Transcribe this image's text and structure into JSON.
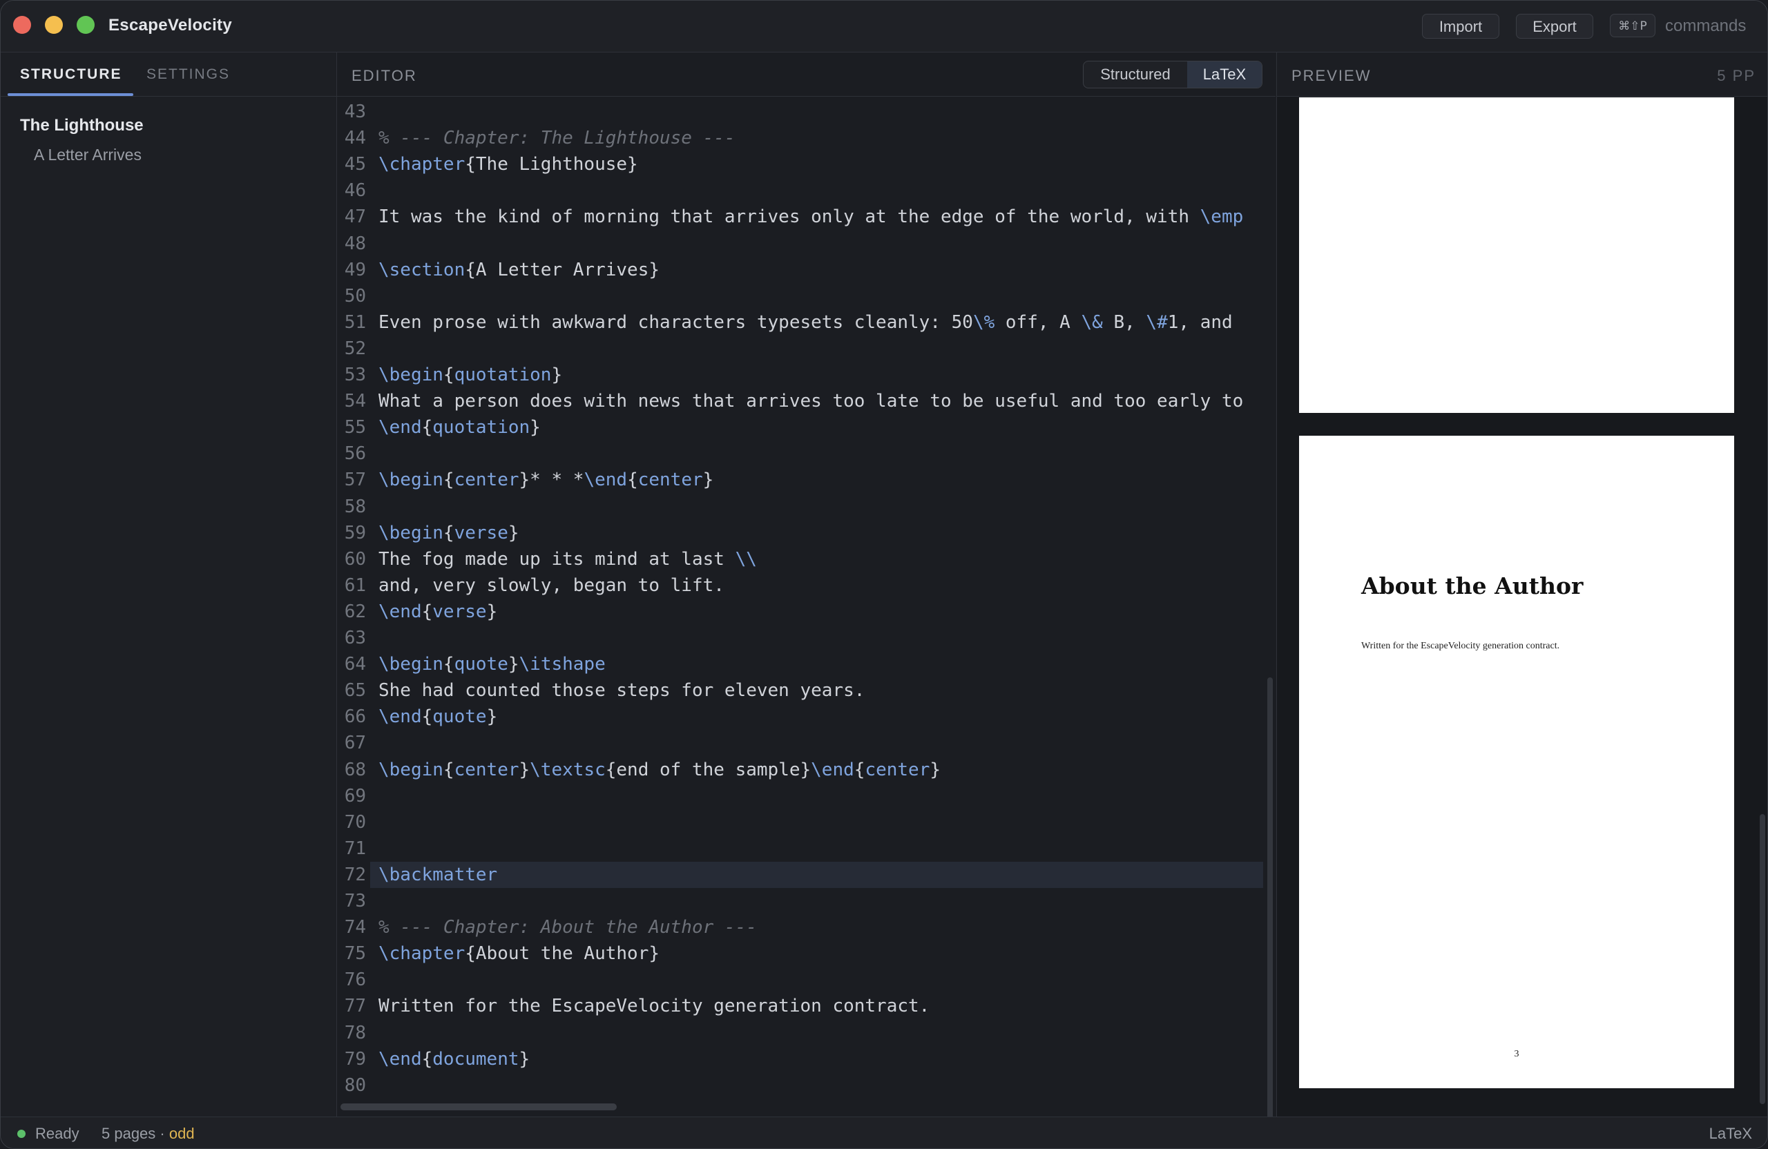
{
  "app": {
    "title": "EscapeVelocity"
  },
  "toolbar": {
    "import_label": "Import",
    "export_label": "Export",
    "shortcut": "⌘⇧P",
    "commands_label": "commands"
  },
  "sidebar": {
    "tabs": [
      {
        "label": "STRUCTURE"
      },
      {
        "label": "SETTINGS"
      }
    ],
    "tree": {
      "chapter": "The Lighthouse",
      "section": "A Letter Arrives"
    }
  },
  "editor": {
    "title": "EDITOR",
    "modes": [
      {
        "label": "Structured"
      },
      {
        "label": "LaTeX"
      }
    ],
    "active_mode": "LaTeX",
    "current_line": 72,
    "lines": [
      {
        "n": "43",
        "t": ""
      },
      {
        "n": "44",
        "t": "% --- Chapter: The Lighthouse ---"
      },
      {
        "n": "45",
        "t": "\\chapter{The Lighthouse}"
      },
      {
        "n": "46",
        "t": ""
      },
      {
        "n": "47",
        "t": "It was the kind of morning that arrives only at the edge of the world, with \\emp"
      },
      {
        "n": "48",
        "t": ""
      },
      {
        "n": "49",
        "t": "\\section{A Letter Arrives}"
      },
      {
        "n": "50",
        "t": ""
      },
      {
        "n": "51",
        "t": "Even prose with awkward characters typesets cleanly: 50\\% off, A \\& B, \\#1, and"
      },
      {
        "n": "52",
        "t": ""
      },
      {
        "n": "53",
        "t": "\\begin{quotation}"
      },
      {
        "n": "54",
        "t": "What a person does with news that arrives too late to be useful and too early to"
      },
      {
        "n": "55",
        "t": "\\end{quotation}"
      },
      {
        "n": "56",
        "t": ""
      },
      {
        "n": "57",
        "t": "\\begin{center}* * *\\end{center}"
      },
      {
        "n": "58",
        "t": ""
      },
      {
        "n": "59",
        "t": "\\begin{verse}"
      },
      {
        "n": "60",
        "t": "The fog made up its mind at last \\\\"
      },
      {
        "n": "61",
        "t": "and, very slowly, began to lift."
      },
      {
        "n": "62",
        "t": "\\end{verse}"
      },
      {
        "n": "63",
        "t": ""
      },
      {
        "n": "64",
        "t": "\\begin{quote}\\itshape"
      },
      {
        "n": "65",
        "t": "She had counted those steps for eleven years."
      },
      {
        "n": "66",
        "t": "\\end{quote}"
      },
      {
        "n": "67",
        "t": ""
      },
      {
        "n": "68",
        "t": "\\begin{center}\\textsc{end of the sample}\\end{center}"
      },
      {
        "n": "69",
        "t": ""
      },
      {
        "n": "70",
        "t": ""
      },
      {
        "n": "71",
        "t": ""
      },
      {
        "n": "72",
        "t": "\\backmatter"
      },
      {
        "n": "73",
        "t": ""
      },
      {
        "n": "74",
        "t": "% --- Chapter: About the Author ---"
      },
      {
        "n": "75",
        "t": "\\chapter{About the Author}"
      },
      {
        "n": "76",
        "t": ""
      },
      {
        "n": "77",
        "t": "Written for the EscapeVelocity generation contract."
      },
      {
        "n": "78",
        "t": ""
      },
      {
        "n": "79",
        "t": "\\end{document}"
      },
      {
        "n": "80",
        "t": ""
      }
    ]
  },
  "preview": {
    "title": "PREVIEW",
    "page_count": "5 PP",
    "page": {
      "heading": "About the Author",
      "body": "Written for the EscapeVelocity generation contract.",
      "number": "3"
    }
  },
  "status": {
    "state": "Ready",
    "pages": "5 pages · ",
    "parity": "odd",
    "mode": "LaTeX"
  },
  "colors": {
    "accent": "#6d8fd6",
    "keyword": "#7fa4de",
    "ready": "#5cc06a",
    "parity": "#e0b552"
  }
}
